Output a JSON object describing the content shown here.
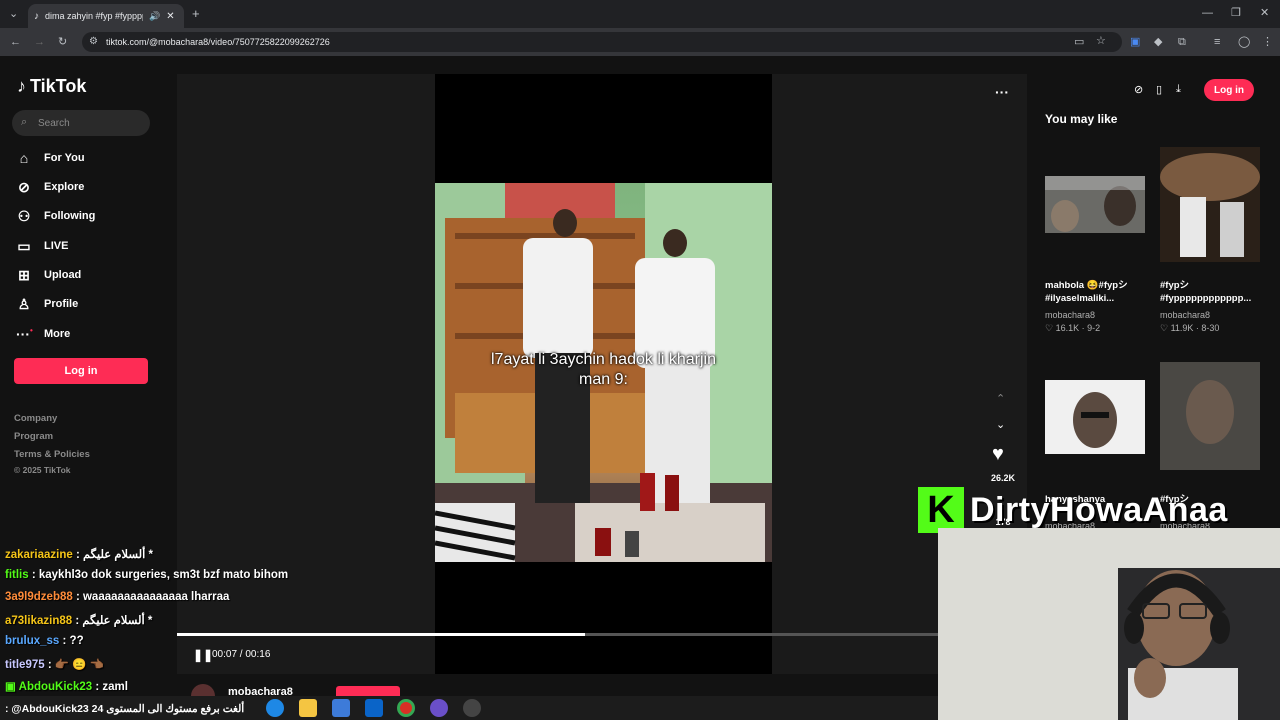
{
  "browser": {
    "tab_title": "dima zahyin #fyp #fypppp",
    "url": "tiktok.com/@mobachara8/video/7507725822099262726",
    "new_tab": "+"
  },
  "sidebar": {
    "logo": "TikTok",
    "search_placeholder": "Search",
    "items": [
      {
        "label": "For You",
        "icon": "home-icon"
      },
      {
        "label": "Explore",
        "icon": "compass-icon"
      },
      {
        "label": "Following",
        "icon": "user-icon"
      },
      {
        "label": "LIVE",
        "icon": "live-icon"
      },
      {
        "label": "Upload",
        "icon": "upload-icon"
      },
      {
        "label": "Profile",
        "icon": "profile-icon"
      },
      {
        "label": "More",
        "icon": "more-icon"
      }
    ],
    "login": "Log in",
    "footer": [
      "Company",
      "Program",
      "Terms & Policies"
    ],
    "copyright": "© 2025 TikTok"
  },
  "video": {
    "caption_line1": "l7ayat li 3aychin hadok li kharjin",
    "caption_line2": "man 9:",
    "time": "00:07 / 00:16",
    "progress": 0.48,
    "likes": "26.2K",
    "comments": "178",
    "author": "mobachara8"
  },
  "right": {
    "login": "Log in",
    "heading": "You may like",
    "recs": [
      {
        "title1": "mahbola 😆#fypシ",
        "title2": "#ilyaselmaliki...",
        "user": "mobachara8",
        "stats": "♡ 16.1K · 9-2"
      },
      {
        "title1": "#fypシ",
        "title2": "#fypppppppppppp...",
        "user": "mobachara8",
        "stats": "♡ 11.9K · 8-30"
      },
      {
        "title1": "hanyashanya",
        "title2": "",
        "user": "mobachara8",
        "stats": ""
      },
      {
        "title1": "#fypシ",
        "title2": "",
        "user": "mobachara8",
        "stats": ""
      }
    ]
  },
  "stream": {
    "brand": "DirtyHowaAnaa",
    "kick_letter": "K"
  },
  "chat": [
    {
      "user": "zakariaazine",
      "msg": " : ألسلام عليگم *",
      "color": "#f5c518"
    },
    {
      "user": "fitlis",
      "msg": " : kaykhl3o dok surgeries, sm3t bzf mato bihom",
      "color": "#53fc18"
    },
    {
      "user": "3a9l9dzeb88",
      "msg": " : waaaaaaaaaaaaaaa lharraa",
      "color": "#ff8c3a"
    },
    {
      "user": "a73likazin88",
      "msg": " : ألسلام عليگم *",
      "color": "#f5c518"
    },
    {
      "user": "brulux_ss",
      "msg": " : ??",
      "color": "#5aa8ff"
    },
    {
      "user": "title975",
      "msg": " : 👉🏾 😑 👈🏾",
      "color": "#c8c8ff"
    },
    {
      "user": "AbdouKick23",
      "msg": " : zaml",
      "color": "#53fc18"
    }
  ],
  "chat_bottom": ": @AbdouKick23 24 ألغت برفع مستوك الى المستوى"
}
